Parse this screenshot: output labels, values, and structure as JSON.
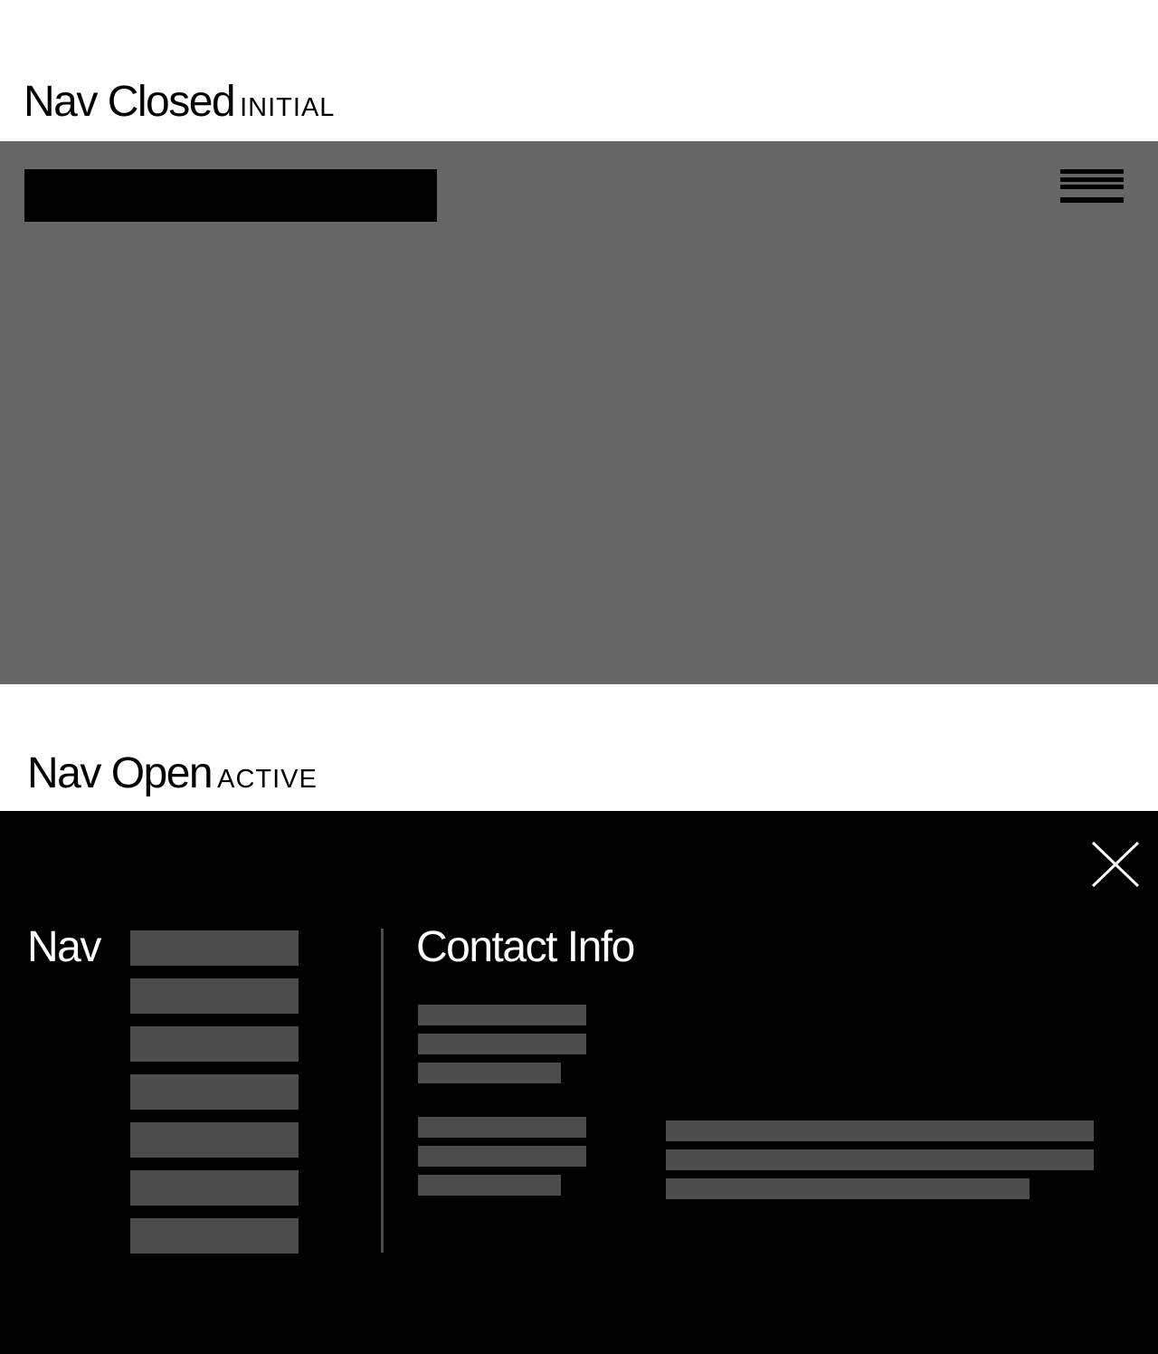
{
  "sections": {
    "closed": {
      "title": "Nav Closed",
      "state_label": "INITIAL",
      "panel_color": "#666666",
      "logo_placeholder_color": "#000000",
      "menu_icon": "hamburger-menu-icon"
    },
    "open": {
      "title": "Nav Open",
      "state_label": "ACTIVE",
      "panel_color": "#000000",
      "close_icon": "close-x-icon",
      "nav": {
        "heading": "Nav",
        "item_count": 7,
        "placeholder_color": "#4c4c4c"
      },
      "contact": {
        "heading": "Contact Info",
        "placeholder_color": "#4c4c4c"
      }
    }
  }
}
